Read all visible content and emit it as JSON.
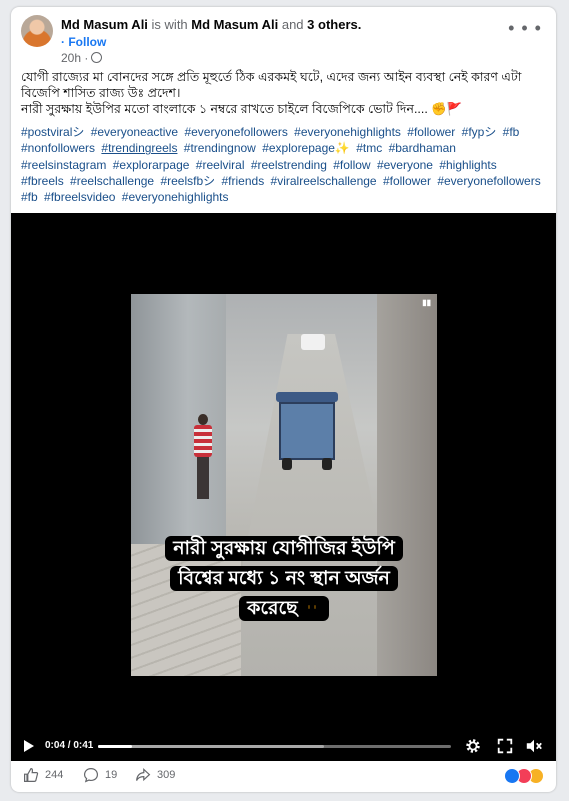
{
  "post": {
    "author": "Md Masum Ali",
    "with_text": "is with",
    "with_person": "Md Masum Ali",
    "and_text": "and",
    "others": "3 others.",
    "follow_label": "· Follow",
    "time": "20h ·",
    "more_icon": "more-horizontal-icon",
    "privacy_icon": "globe-icon",
    "text_line1": "যোগী রাজ্যের  মা বোনদের সঙ্গে প্রতি মূহুর্তে ঠিক এরকমই ঘটে,  এদের জন্য আইন ব্যবস্থা নেই কারণ এটা বিজেপি শাসিত রাজ্য উঃ প্রদেশ।",
    "text_line2": "নারী সুরক্ষায় ইউপির মতো  বাংলাকে ১ নম্বরে রাখতে চাইলে বিজেপিকে ভোট দিন....",
    "text_line2_emoji": "✊🚩",
    "hashtags": [
      "#postviralシ",
      "#everyoneactive",
      "#everyonefollowers",
      "#everyonehighlights",
      "#follower",
      "#fypシ",
      "#fb",
      "#nonfollowers",
      "#trendingreels",
      "#trendingnow",
      " #explorepage✨",
      "#tmc",
      "#bardhaman",
      "#reelsinstagram",
      "#explorarpage",
      "#reelviral",
      "#reelstrending",
      "#follow",
      "#everyone",
      "#highlights",
      " #fbreels",
      "#reelschallenge",
      "#reelsfbシ",
      "#friends",
      "#viralreelschallenge",
      "#follower",
      "#everyonefollowers",
      "#fb",
      "#fbreelsvideo",
      "#everyonehighlights"
    ]
  },
  "video": {
    "overlay_line1": "নারী সুরক্ষায় যোগীজির ইউপি",
    "overlay_line2": "বিশ্বের মধ্যে ১ নং স্থান অর্জন",
    "overlay_line3": "করেছে",
    "time_display": "0:04 / 0:41",
    "progress_fraction": 0.0976,
    "buffer_fraction": 0.64,
    "controls": [
      "play-icon",
      "settings-icon",
      "fullscreen-icon",
      "mute-icon"
    ]
  },
  "footer": {
    "like_count": "244",
    "comment_count": "19",
    "share_count": "309",
    "reaction_colors": [
      "#1877f2",
      "#f33e58",
      "#f7b125"
    ]
  }
}
